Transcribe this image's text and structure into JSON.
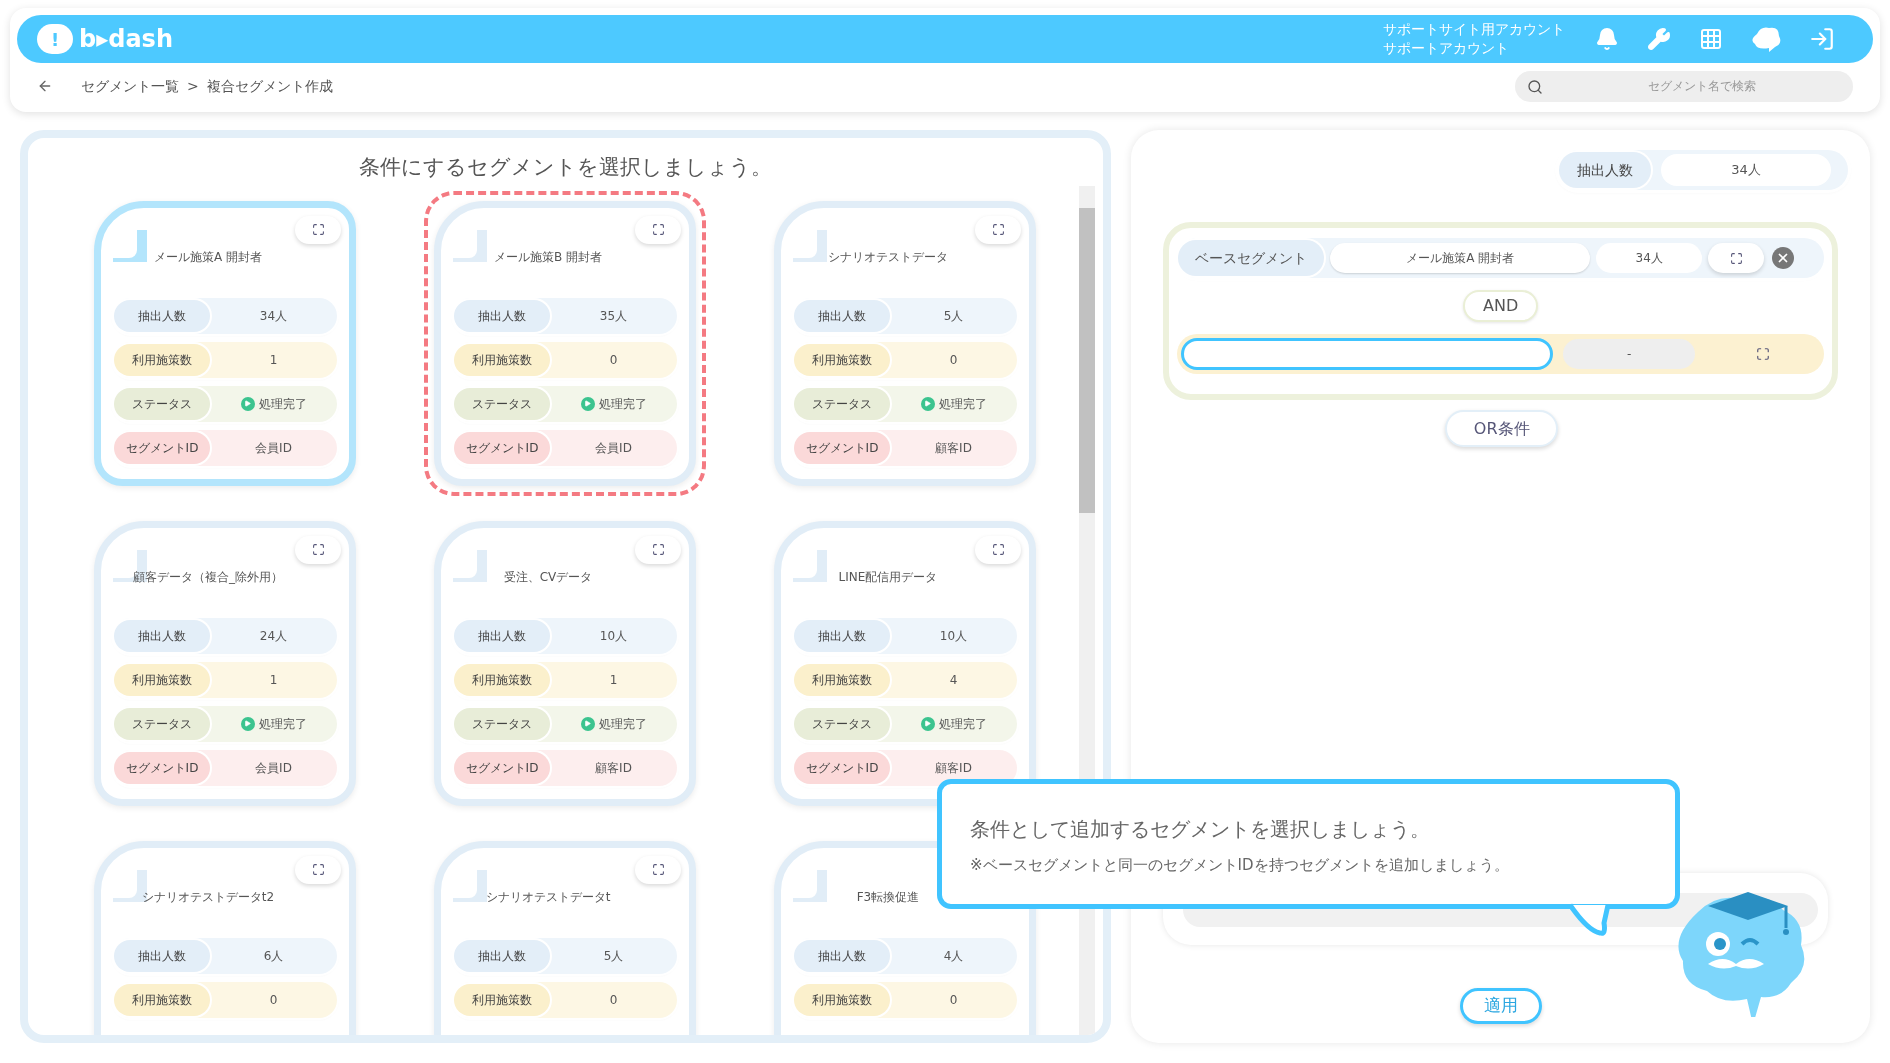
{
  "header": {
    "logo_mark": "!",
    "logo_text": "b▸dash",
    "account_lines": [
      "サポートサイト用アカウント",
      "サポートアカウント"
    ]
  },
  "breadcrumb": {
    "items": [
      "セグメント一覧",
      "複合セグメント作成"
    ],
    "separator": ">"
  },
  "search": {
    "placeholder": "セグメント名で検索"
  },
  "left_panel": {
    "title": "条件にするセグメントを選択しましょう。",
    "cards": [
      {
        "title": "メール施策A 開封者",
        "selected": true,
        "highlighted": false,
        "rows": [
          {
            "kind": "count",
            "label": "抽出人数",
            "value": "34人"
          },
          {
            "kind": "measures",
            "label": "利用施策数",
            "value": "1"
          },
          {
            "kind": "status",
            "label": "ステータス",
            "value": "処理完了"
          },
          {
            "kind": "id",
            "label": "セグメントID",
            "value": "会員ID"
          }
        ]
      },
      {
        "title": "メール施策B 開封者",
        "selected": false,
        "highlighted": true,
        "rows": [
          {
            "kind": "count",
            "label": "抽出人数",
            "value": "35人"
          },
          {
            "kind": "measures",
            "label": "利用施策数",
            "value": "0"
          },
          {
            "kind": "status",
            "label": "ステータス",
            "value": "処理完了"
          },
          {
            "kind": "id",
            "label": "セグメントID",
            "value": "会員ID"
          }
        ]
      },
      {
        "title": "シナリオテストデータ",
        "selected": false,
        "highlighted": false,
        "rows": [
          {
            "kind": "count",
            "label": "抽出人数",
            "value": "5人"
          },
          {
            "kind": "measures",
            "label": "利用施策数",
            "value": "0"
          },
          {
            "kind": "status",
            "label": "ステータス",
            "value": "処理完了"
          },
          {
            "kind": "id",
            "label": "セグメントID",
            "value": "顧客ID"
          }
        ]
      },
      {
        "title": "顧客データ（複合_除外用）",
        "selected": false,
        "highlighted": false,
        "rows": [
          {
            "kind": "count",
            "label": "抽出人数",
            "value": "24人"
          },
          {
            "kind": "measures",
            "label": "利用施策数",
            "value": "1"
          },
          {
            "kind": "status",
            "label": "ステータス",
            "value": "処理完了"
          },
          {
            "kind": "id",
            "label": "セグメントID",
            "value": "会員ID"
          }
        ]
      },
      {
        "title": "受注、CVデータ",
        "selected": false,
        "highlighted": false,
        "rows": [
          {
            "kind": "count",
            "label": "抽出人数",
            "value": "10人"
          },
          {
            "kind": "measures",
            "label": "利用施策数",
            "value": "1"
          },
          {
            "kind": "status",
            "label": "ステータス",
            "value": "処理完了"
          },
          {
            "kind": "id",
            "label": "セグメントID",
            "value": "顧客ID"
          }
        ]
      },
      {
        "title": "LINE配信用データ",
        "selected": false,
        "highlighted": false,
        "rows": [
          {
            "kind": "count",
            "label": "抽出人数",
            "value": "10人"
          },
          {
            "kind": "measures",
            "label": "利用施策数",
            "value": "4"
          },
          {
            "kind": "status",
            "label": "ステータス",
            "value": "処理完了"
          },
          {
            "kind": "id",
            "label": "セグメントID",
            "value": "顧客ID"
          }
        ]
      },
      {
        "title": "シナリオテストデータt2",
        "selected": false,
        "highlighted": false,
        "rows": [
          {
            "kind": "count",
            "label": "抽出人数",
            "value": "6人"
          },
          {
            "kind": "measures",
            "label": "利用施策数",
            "value": "0"
          }
        ]
      },
      {
        "title": "シナリオテストデータt",
        "selected": false,
        "highlighted": false,
        "rows": [
          {
            "kind": "count",
            "label": "抽出人数",
            "value": "5人"
          },
          {
            "kind": "measures",
            "label": "利用施策数",
            "value": "0"
          }
        ]
      },
      {
        "title": "F3転換促進",
        "selected": false,
        "highlighted": false,
        "rows": [
          {
            "kind": "count",
            "label": "抽出人数",
            "value": "4人"
          },
          {
            "kind": "measures",
            "label": "利用施策数",
            "value": "0"
          }
        ]
      }
    ]
  },
  "right_panel": {
    "total": {
      "label": "抽出人数",
      "value": "34人"
    },
    "base": {
      "label": "ベースセグメント",
      "name": "メール施策A 開封者",
      "count": "34人"
    },
    "operator": "AND",
    "condition": {
      "count": "-"
    },
    "or_button": "OR条件",
    "apply_button": "適用"
  },
  "tooltip": {
    "title": "条件として追加するセグメントを選択しましょう。",
    "note": "※ベースセグメントと同一のセグメントIDを持つセグメントを追加しましょう。"
  }
}
